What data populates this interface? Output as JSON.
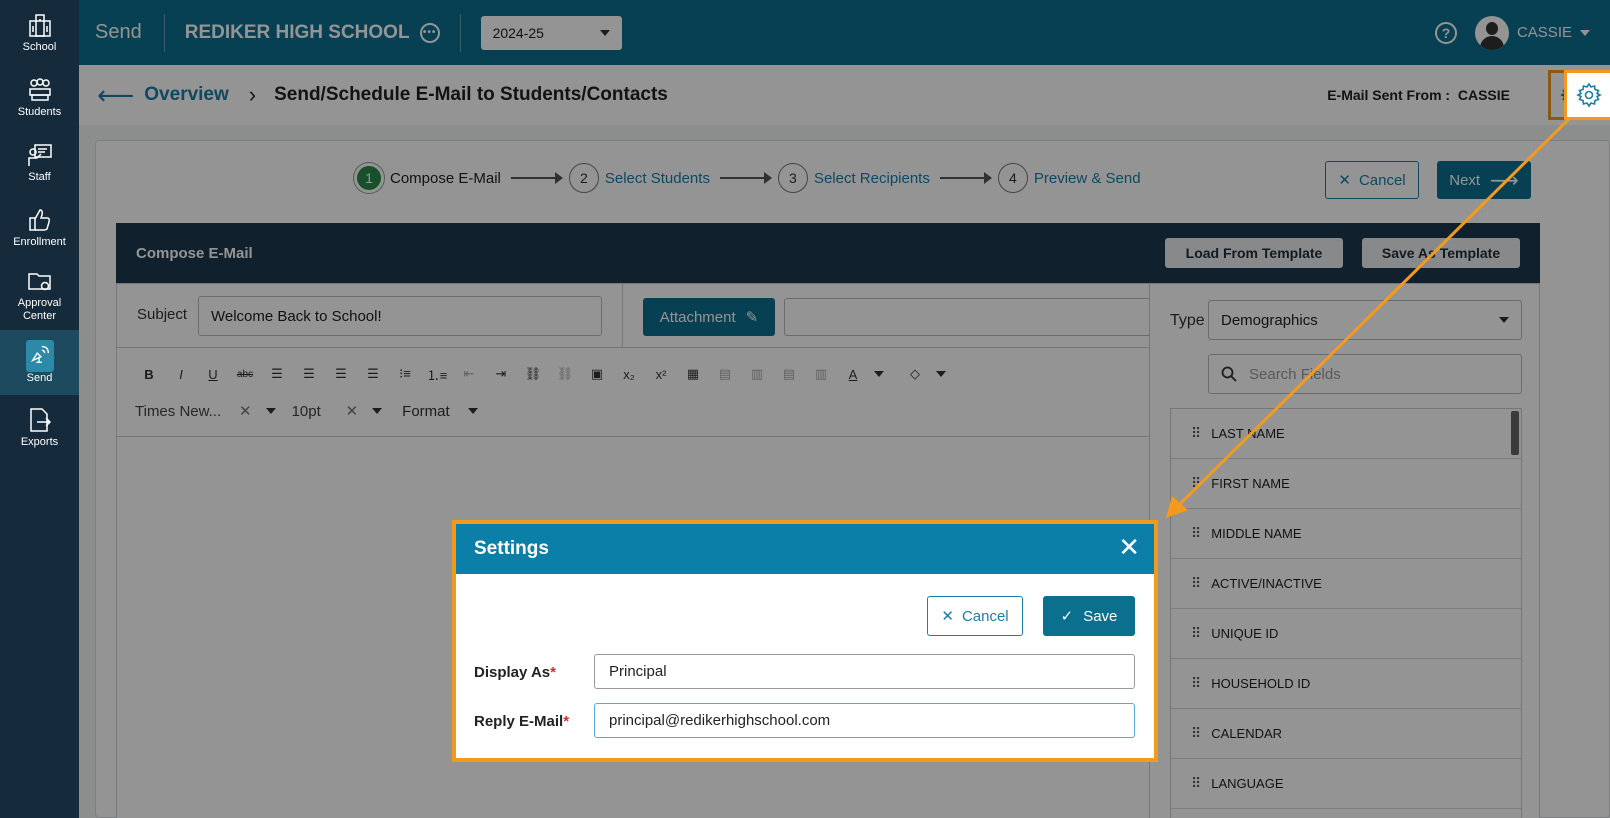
{
  "nav": {
    "items": [
      {
        "label": "School",
        "icon": "building-icon"
      },
      {
        "label": "Students",
        "icon": "students-icon"
      },
      {
        "label": "Staff",
        "icon": "staff-icon"
      },
      {
        "label": "Enrollment",
        "icon": "thumbs-up-icon"
      },
      {
        "label": "Approval Center",
        "icon": "folder-gear-icon"
      },
      {
        "label": "Send",
        "icon": "send-icon",
        "active": true
      },
      {
        "label": "Exports",
        "icon": "export-icon"
      }
    ]
  },
  "topbar": {
    "module": "Send",
    "school": "REDIKER HIGH SCHOOL",
    "year": "2024-25",
    "user": "CASSIE"
  },
  "breadcrumb": {
    "parent": "Overview",
    "title": "Send/Schedule E-Mail to Students/Contacts",
    "sent_from_label": "E-Mail Sent From :",
    "sent_from_value": "CASSIE"
  },
  "steps": [
    {
      "num": "1",
      "label": "Compose E-Mail"
    },
    {
      "num": "2",
      "label": "Select Students"
    },
    {
      "num": "3",
      "label": "Select Recipients"
    },
    {
      "num": "4",
      "label": "Preview & Send"
    }
  ],
  "actions": {
    "cancel": "Cancel",
    "next": "Next"
  },
  "compose": {
    "heading": "Compose E-Mail",
    "load_template": "Load From Template",
    "save_template": "Save As Template",
    "subject_label": "Subject",
    "subject_value": "Welcome Back to School!",
    "attachment": "Attachment",
    "font_family": "Times New...",
    "font_size": "10pt",
    "format": "Format"
  },
  "fields_panel": {
    "type_label": "Type",
    "type_value": "Demographics",
    "search_placeholder": "Search Fields",
    "fields": [
      "LAST NAME",
      "FIRST NAME",
      "MIDDLE NAME",
      "ACTIVE/INACTIVE",
      "UNIQUE ID",
      "HOUSEHOLD ID",
      "CALENDAR",
      "LANGUAGE"
    ]
  },
  "modal": {
    "title": "Settings",
    "cancel": "Cancel",
    "save": "Save",
    "display_as_label": "Display As",
    "display_as_value": "Principal",
    "reply_label": "Reply E-Mail",
    "reply_value": "principal@redikerhighschool.com"
  },
  "colors": {
    "topbar": "#0b6f8e",
    "nav": "#152a3a",
    "highlight": "#f39a1c",
    "step_active": "#2a8a4a"
  }
}
